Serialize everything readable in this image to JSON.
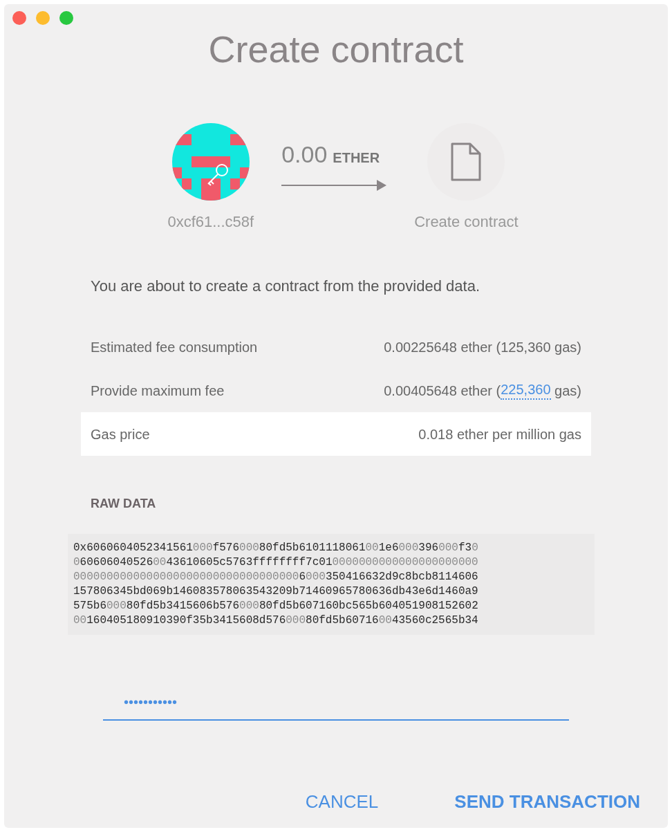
{
  "window": {
    "title": "Create contract"
  },
  "transfer": {
    "from_address": "0xcf61...c58f",
    "amount": "0.00",
    "unit": "ETHER",
    "to_label": "Create contract"
  },
  "description": "You are about to create a contract from the provided data.",
  "fees": [
    {
      "label": "Estimated fee consumption",
      "value": "0.00225648 ether (125,360 gas)",
      "highlighted": false
    },
    {
      "label": "Provide maximum fee",
      "value": "0.00405648 ether (",
      "link": "225,360",
      "suffix": " gas)",
      "highlighted": false
    },
    {
      "label": "Gas price",
      "value": "0.018 ether per million gas",
      "highlighted": true
    }
  ],
  "raw_data": {
    "heading": "RAW DATA",
    "lines": [
      [
        {
          "text": "0x6060604052341561",
          "dim": false
        },
        {
          "text": "000",
          "dim": true
        },
        {
          "text": "f576",
          "dim": false
        },
        {
          "text": "000",
          "dim": true
        },
        {
          "text": "80fd5b6101118061",
          "dim": false
        },
        {
          "text": "00",
          "dim": true
        },
        {
          "text": "1e6",
          "dim": false
        },
        {
          "text": "000",
          "dim": true
        },
        {
          "text": "396",
          "dim": false
        },
        {
          "text": "000",
          "dim": true
        },
        {
          "text": "f3",
          "dim": false
        },
        {
          "text": "0",
          "dim": true
        }
      ],
      [
        {
          "text": "0",
          "dim": true
        },
        {
          "text": "60606040526",
          "dim": false
        },
        {
          "text": "00",
          "dim": true
        },
        {
          "text": "43610605c5763ffffffff7c01",
          "dim": false
        },
        {
          "text": "0000000000000000000000",
          "dim": true
        }
      ],
      [
        {
          "text": "0000000000000000000000000000000000",
          "dim": true
        },
        {
          "text": "6",
          "dim": false
        },
        {
          "text": "000",
          "dim": true
        },
        {
          "text": "350416632d9c8bcb8114606",
          "dim": false
        }
      ],
      [
        {
          "text": "157806345bd069b146083578063543209b71460965780636db43e6d1460a9",
          "dim": false
        }
      ],
      [
        {
          "text": "575b6",
          "dim": false
        },
        {
          "text": "000",
          "dim": true
        },
        {
          "text": "80fd5b3415606b576",
          "dim": false
        },
        {
          "text": "000",
          "dim": true
        },
        {
          "text": "80fd5b607160bc565b604051908152602",
          "dim": false
        }
      ],
      [
        {
          "text": "00",
          "dim": true
        },
        {
          "text": "160405180910390f35b3415608d576",
          "dim": false
        },
        {
          "text": "000",
          "dim": true
        },
        {
          "text": "80fd5b60716",
          "dim": false
        },
        {
          "text": "00",
          "dim": true
        },
        {
          "text": "43560c2565b34",
          "dim": false
        }
      ]
    ]
  },
  "password": {
    "value": "•••••••••••"
  },
  "buttons": [
    {
      "label": "CANCEL",
      "kind": "secondary"
    },
    {
      "label": "SEND TRANSACTION",
      "kind": "primary"
    }
  ]
}
